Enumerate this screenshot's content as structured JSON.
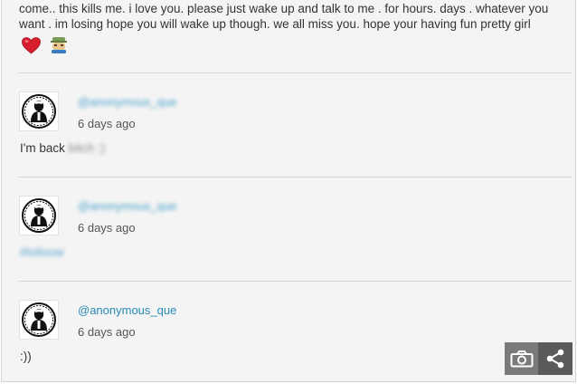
{
  "top_post": {
    "text": "come.. this kills me. i love you. please just wake up and talk to me . for hours. days . whatever you want . im losing hope you will wake up though. we all miss you. hope your having fun pretty girl"
  },
  "posts": [
    {
      "username": "@anonymous_que",
      "time": "6 days ago",
      "body_visible": "I'm back",
      "body_blurred": "bitch :)"
    },
    {
      "username": "@anonymous_que",
      "time": "6 days ago",
      "body_blurred": "#lolloow"
    },
    {
      "username": "@anonymous_que",
      "time": "6 days ago",
      "body_visible": ":))"
    }
  ],
  "colors": {
    "link": "#2a8ab8",
    "heart": "#d81e2c",
    "toolbar": "#6c6c6c"
  },
  "icons": [
    "red-heart-emoji",
    "face-emoji",
    "anonymous-mask-avatar",
    "camera-icon",
    "share-icon"
  ]
}
